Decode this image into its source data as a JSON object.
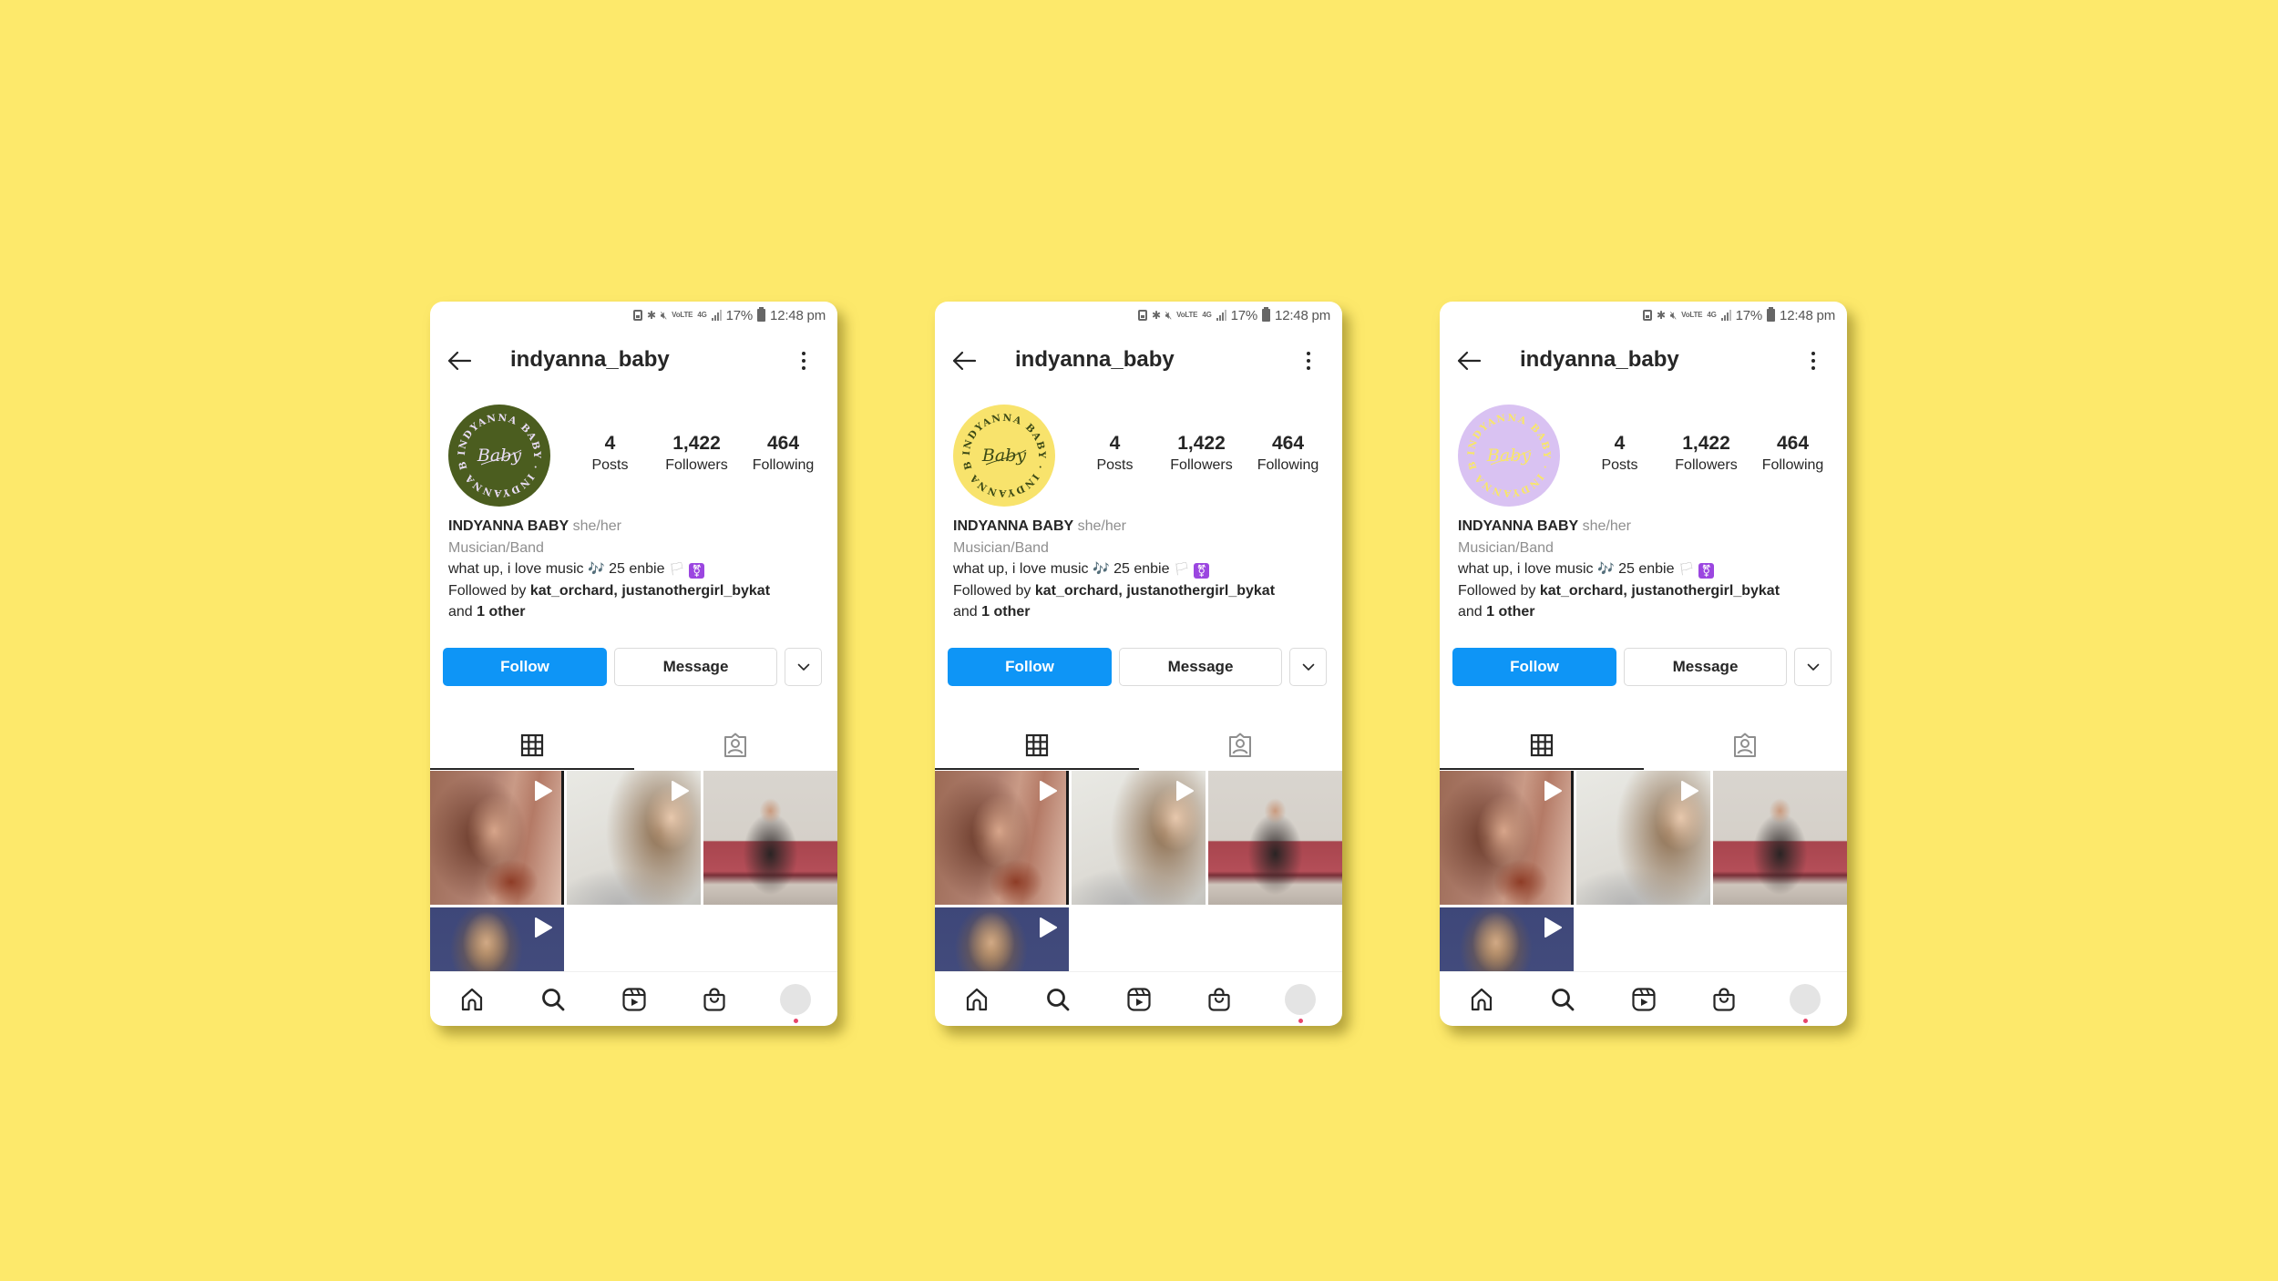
{
  "background_color": "#fde96b",
  "phones": [
    {
      "variant": "green",
      "avatar_colors": {
        "bg": "#4b5d1f",
        "text": "#e9ddf5"
      },
      "status_bar": {
        "battery_percent": "17%",
        "time": "12:48 pm",
        "network": "4G",
        "volte": "VoLTE"
      },
      "header": {
        "username": "indyanna_baby",
        "back_icon": "arrow-left-icon",
        "more_icon": "more-vertical-icon"
      },
      "avatar_text": {
        "ring": "INDYANNA BABY · INDYANNA BABY ·",
        "script": "Baby"
      },
      "stats": [
        {
          "value": "4",
          "label": "Posts"
        },
        {
          "value": "1,422",
          "label": "Followers"
        },
        {
          "value": "464",
          "label": "Following"
        }
      ],
      "bio": {
        "name": "INDYANNA BABY",
        "pronouns": "she/her",
        "category": "Musician/Band",
        "text": "what up, i love music",
        "emoji_notes": "🎶",
        "text_2": "25 enbie",
        "emoji_flag": "🏳",
        "emoji_trans": "⚧",
        "followed_by_prefix": "Followed by",
        "followed_by_users": "kat_orchard, justanothergirl_bykat",
        "and": "and",
        "others": "1 other"
      },
      "actions": {
        "follow": "Follow",
        "message": "Message",
        "dropdown_icon": "chevron-down-icon"
      },
      "tabs": [
        {
          "icon": "grid-icon",
          "active": true
        },
        {
          "icon": "tagged-icon",
          "active": false
        }
      ],
      "posts": [
        {
          "type": "video",
          "thumb": "person-playing-guitar-warm"
        },
        {
          "type": "video",
          "thumb": "closeup-long-hair"
        },
        {
          "type": "image",
          "thumb": "person-guitar-red-couch"
        },
        {
          "type": "video",
          "thumb": "person-blue-wall"
        }
      ],
      "bottom_nav": [
        "home-icon",
        "search-icon",
        "reels-icon",
        "shop-icon",
        "profile-avatar"
      ]
    },
    {
      "variant": "yellow",
      "avatar_colors": {
        "bg": "#f8e36c",
        "text": "#3c4a16"
      },
      "status_bar": {
        "battery_percent": "17%",
        "time": "12:48 pm",
        "network": "4G",
        "volte": "VoLTE"
      },
      "header": {
        "username": "indyanna_baby",
        "back_icon": "arrow-left-icon",
        "more_icon": "more-vertical-icon"
      },
      "avatar_text": {
        "ring": "INDYANNA BABY · INDYANNA BABY ·",
        "script": "Baby"
      },
      "stats": [
        {
          "value": "4",
          "label": "Posts"
        },
        {
          "value": "1,422",
          "label": "Followers"
        },
        {
          "value": "464",
          "label": "Following"
        }
      ],
      "bio": {
        "name": "INDYANNA BABY",
        "pronouns": "she/her",
        "category": "Musician/Band",
        "text": "what up, i love music",
        "emoji_notes": "🎶",
        "text_2": "25 enbie",
        "emoji_flag": "🏳",
        "emoji_trans": "⚧",
        "followed_by_prefix": "Followed by",
        "followed_by_users": "kat_orchard, justanothergirl_bykat",
        "and": "and",
        "others": "1 other"
      },
      "actions": {
        "follow": "Follow",
        "message": "Message",
        "dropdown_icon": "chevron-down-icon"
      },
      "tabs": [
        {
          "icon": "grid-icon",
          "active": true
        },
        {
          "icon": "tagged-icon",
          "active": false
        }
      ],
      "posts": [
        {
          "type": "video",
          "thumb": "person-playing-guitar-warm"
        },
        {
          "type": "video",
          "thumb": "closeup-long-hair"
        },
        {
          "type": "image",
          "thumb": "person-guitar-red-couch"
        },
        {
          "type": "video",
          "thumb": "person-blue-wall"
        }
      ],
      "bottom_nav": [
        "home-icon",
        "search-icon",
        "reels-icon",
        "shop-icon",
        "profile-avatar"
      ]
    },
    {
      "variant": "lavender",
      "avatar_colors": {
        "bg": "#d9c2f2",
        "text": "#f8e66a"
      },
      "status_bar": {
        "battery_percent": "17%",
        "time": "12:48 pm",
        "network": "4G",
        "volte": "VoLTE"
      },
      "header": {
        "username": "indyanna_baby",
        "back_icon": "arrow-left-icon",
        "more_icon": "more-vertical-icon"
      },
      "avatar_text": {
        "ring": "INDYANNA BABY · INDYANNA BABY ·",
        "script": "Baby"
      },
      "stats": [
        {
          "value": "4",
          "label": "Posts"
        },
        {
          "value": "1,422",
          "label": "Followers"
        },
        {
          "value": "464",
          "label": "Following"
        }
      ],
      "bio": {
        "name": "INDYANNA BABY",
        "pronouns": "she/her",
        "category": "Musician/Band",
        "text": "what up, i love music",
        "emoji_notes": "🎶",
        "text_2": "25 enbie",
        "emoji_flag": "🏳",
        "emoji_trans": "⚧",
        "followed_by_prefix": "Followed by",
        "followed_by_users": "kat_orchard, justanothergirl_bykat",
        "and": "and",
        "others": "1 other"
      },
      "actions": {
        "follow": "Follow",
        "message": "Message",
        "dropdown_icon": "chevron-down-icon"
      },
      "tabs": [
        {
          "icon": "grid-icon",
          "active": true
        },
        {
          "icon": "tagged-icon",
          "active": false
        }
      ],
      "posts": [
        {
          "type": "video",
          "thumb": "person-playing-guitar-warm"
        },
        {
          "type": "video",
          "thumb": "closeup-long-hair"
        },
        {
          "type": "image",
          "thumb": "person-guitar-red-couch"
        },
        {
          "type": "video",
          "thumb": "person-blue-wall"
        }
      ],
      "bottom_nav": [
        "home-icon",
        "search-icon",
        "reels-icon",
        "shop-icon",
        "profile-avatar"
      ]
    }
  ]
}
